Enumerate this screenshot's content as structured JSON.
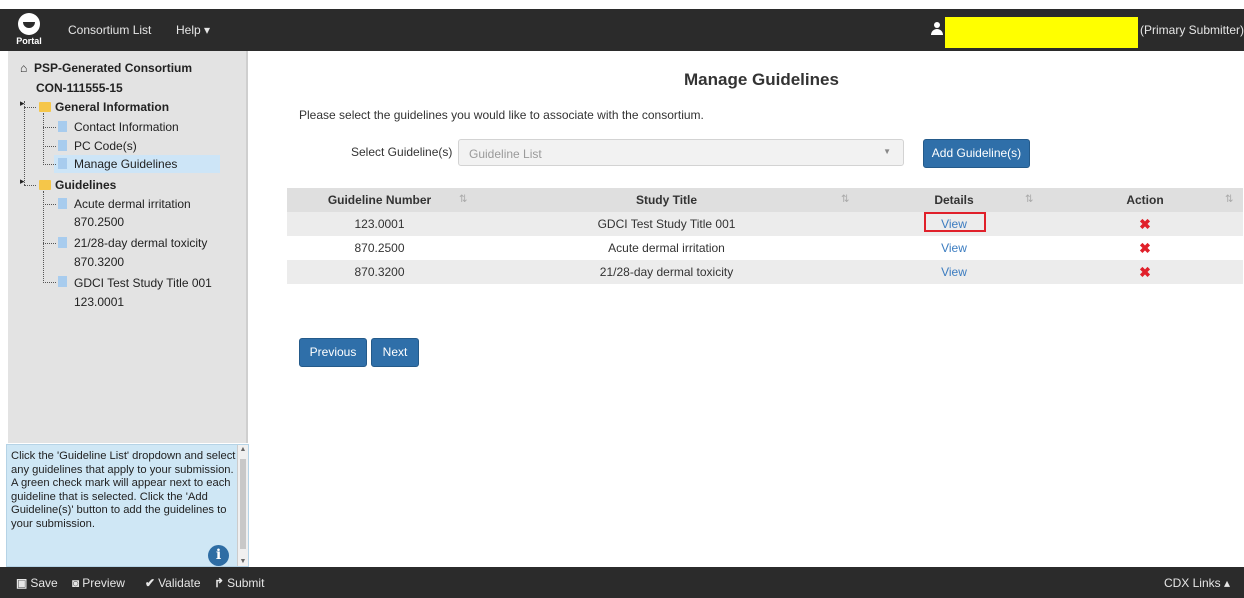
{
  "navbar": {
    "logo_text": "Portal",
    "consortium_list": "Consortium List",
    "help": "Help ▾",
    "user_role": "(Primary Submitter)"
  },
  "sidebar": {
    "root_label": "PSP-Generated Consortium",
    "root_id": "CON-111555-15",
    "general_info": "General Information",
    "contact_info": "Contact Information",
    "pc_codes": "PC Code(s)",
    "manage_guidelines": "Manage Guidelines",
    "guidelines": "Guidelines",
    "items": [
      {
        "title": "Acute dermal irritation",
        "number": "870.2500"
      },
      {
        "title": "21/28-day dermal toxicity",
        "number": "870.3200"
      },
      {
        "title": "GDCI Test Study Title 001",
        "number": "123.0001"
      }
    ]
  },
  "help_panel": {
    "text": "Click the 'Guideline List' dropdown and select any guidelines that apply to your submission. A green check mark will appear next to each guideline that is selected. Click the 'Add Guideline(s)' button to add the guidelines to your submission.",
    "icon": "i"
  },
  "main": {
    "title": "Manage Guidelines",
    "intro": "Please select the guidelines you would like to associate with the consortium.",
    "select_label": "Select Guideline(s)",
    "select_placeholder": "Guideline List",
    "add_button": "Add Guideline(s)",
    "table": {
      "headers": [
        "Guideline Number",
        "Study Title",
        "Details",
        "Action"
      ],
      "rows": [
        {
          "number": "123.0001",
          "title": "GDCI Test Study Title 001",
          "details": "View",
          "action": "✖"
        },
        {
          "number": "870.2500",
          "title": "Acute dermal irritation",
          "details": "View",
          "action": "✖"
        },
        {
          "number": "870.3200",
          "title": "21/28-day dermal toxicity",
          "details": "View",
          "action": "✖"
        }
      ]
    },
    "previous": "Previous",
    "next": "Next"
  },
  "bottombar": {
    "save": "Save",
    "preview": "Preview",
    "validate": "Validate",
    "submit": "Submit",
    "cdx_links": "CDX Links ▴"
  },
  "colors": {
    "navbar_bg": "#2b2b2b",
    "primary_button": "#2f6fa9",
    "link": "#3b7cc0",
    "danger": "#e0202a",
    "highlight_yellow": "#ffff00"
  }
}
